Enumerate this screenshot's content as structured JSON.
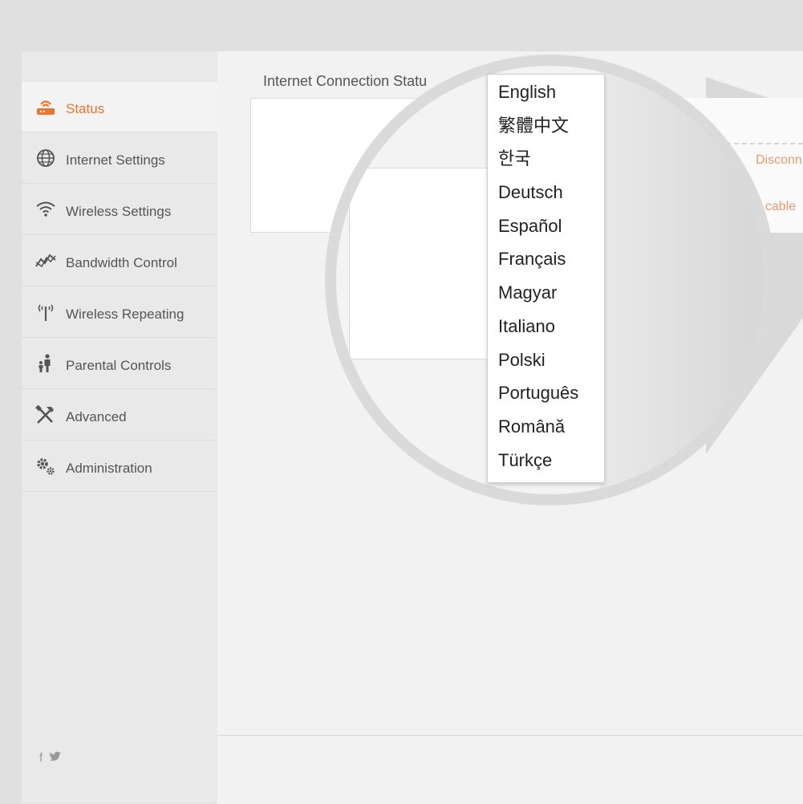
{
  "sidebar": {
    "items": [
      {
        "label": "Status",
        "icon": "router-icon",
        "active": true
      },
      {
        "label": "Internet Settings",
        "icon": "globe-icon",
        "active": false
      },
      {
        "label": "Wireless Settings",
        "icon": "wifi-icon",
        "active": false
      },
      {
        "label": "Bandwidth Control",
        "icon": "bandwidth-icon",
        "active": false
      },
      {
        "label": "Wireless Repeating",
        "icon": "antenna-icon",
        "active": false
      },
      {
        "label": "Parental Controls",
        "icon": "parent-child-icon",
        "active": false
      },
      {
        "label": "Advanced",
        "icon": "tools-icon",
        "active": false
      },
      {
        "label": "Administration",
        "icon": "gears-icon",
        "active": false
      }
    ],
    "social": {
      "facebook": "f",
      "twitter": "twitter-icon"
    }
  },
  "main": {
    "section_title": "Internet Connection Statu",
    "status_text": "Disconn",
    "cable_text": "t cable"
  },
  "language_menu": {
    "options": [
      "English",
      "繁體中文",
      "한국",
      "Deutsch",
      "Español",
      "Français",
      "Magyar",
      "Italiano",
      "Polski",
      "Português",
      "Română",
      "Türkçe"
    ]
  },
  "colors": {
    "accent": "#e8762c",
    "text": "#555555",
    "status": "#e39a72"
  }
}
